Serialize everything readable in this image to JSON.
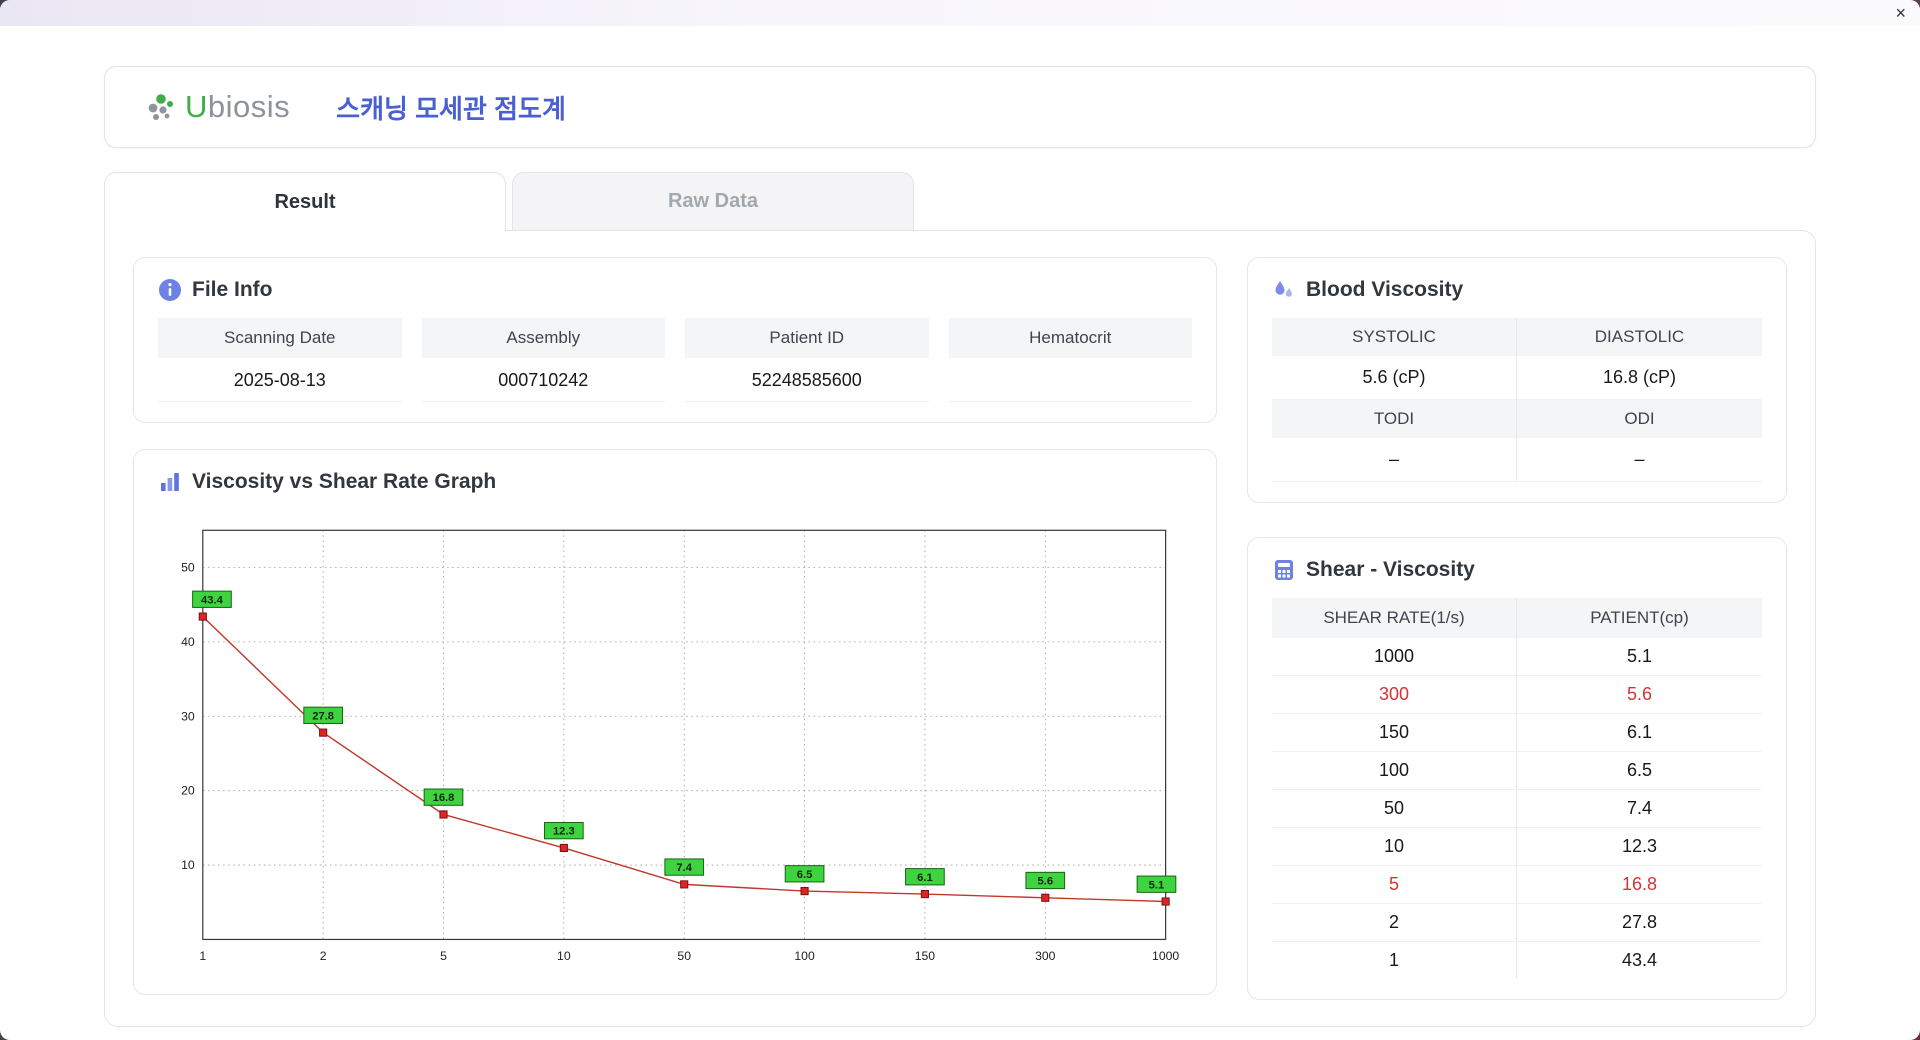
{
  "window": {
    "close_icon": "×"
  },
  "header": {
    "brand_accent": "U",
    "brand_rest": "biosis",
    "logo_icon": "ubiosis-dots-logo",
    "title": "스캐닝 모세관 점도계"
  },
  "tabs": [
    {
      "label": "Result",
      "active": true
    },
    {
      "label": "Raw Data",
      "active": false
    }
  ],
  "file_info": {
    "icon": "info-icon",
    "title": "File Info",
    "fields": [
      {
        "label": "Scanning Date",
        "value": "2025-08-13"
      },
      {
        "label": "Assembly",
        "value": "000710242"
      },
      {
        "label": "Patient ID",
        "value": "52248585600"
      },
      {
        "label": "Hematocrit",
        "value": ""
      }
    ]
  },
  "blood_viscosity": {
    "icon": "droplets-icon",
    "title": "Blood Viscosity",
    "rows": [
      {
        "headers": [
          "SYSTOLIC",
          "DIASTOLIC"
        ],
        "values": [
          "5.6 (cP)",
          "16.8 (cP)"
        ]
      },
      {
        "headers": [
          "TODI",
          "ODI"
        ],
        "values": [
          "–",
          "–"
        ]
      }
    ]
  },
  "graph": {
    "icon": "bar-chart-icon",
    "title": "Viscosity vs Shear Rate Graph"
  },
  "chart_data": {
    "type": "line",
    "title": "Viscosity vs Shear Rate Graph",
    "categories": [
      "1",
      "2",
      "5",
      "10",
      "50",
      "100",
      "150",
      "300",
      "1000"
    ],
    "values": [
      43.4,
      27.8,
      16.8,
      12.3,
      7.4,
      6.5,
      6.1,
      5.6,
      5.1
    ],
    "y_ticks": [
      10,
      20,
      30,
      40,
      50
    ],
    "ylim": [
      0,
      55
    ],
    "grid": true,
    "legend": "none",
    "line_color": "#c0392b",
    "marker_color": "#e02424",
    "label_bg": "#3fd43f",
    "label_border": "#156615"
  },
  "shear_viscosity": {
    "icon": "calculator-icon",
    "title": "Shear - Viscosity",
    "columns": [
      "SHEAR RATE(1/s)",
      "PATIENT(cp)"
    ],
    "rows": [
      {
        "shear": "1000",
        "patient": "5.1",
        "highlight": false
      },
      {
        "shear": "300",
        "patient": "5.6",
        "highlight": true
      },
      {
        "shear": "150",
        "patient": "6.1",
        "highlight": false
      },
      {
        "shear": "100",
        "patient": "6.5",
        "highlight": false
      },
      {
        "shear": "50",
        "patient": "7.4",
        "highlight": false
      },
      {
        "shear": "10",
        "patient": "12.3",
        "highlight": false
      },
      {
        "shear": "5",
        "patient": "16.8",
        "highlight": true
      },
      {
        "shear": "2",
        "patient": "27.8",
        "highlight": false
      },
      {
        "shear": "1",
        "patient": "43.4",
        "highlight": false
      }
    ]
  }
}
